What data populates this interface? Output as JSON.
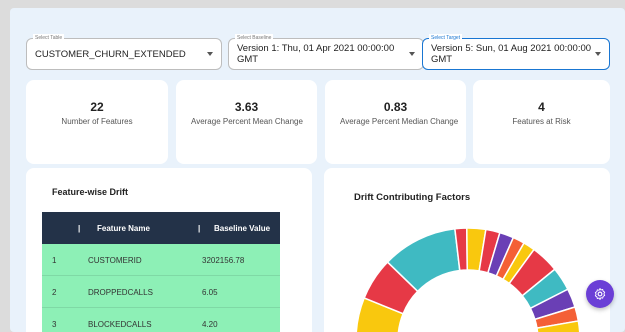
{
  "filters": {
    "table": {
      "legend": "Select Table",
      "value": "CUSTOMER_CHURN_EXTENDED"
    },
    "baseline": {
      "legend": "Select Baseline",
      "value": "Version 1: Thu, 01 Apr 2021 00:00:00 GMT"
    },
    "target": {
      "legend": "Select Target",
      "value": "Version 5: Sun, 01 Aug 2021 00:00:00 GMT"
    }
  },
  "metrics": [
    {
      "value": "22",
      "label": "Number of Features"
    },
    {
      "value": "3.63",
      "label": "Average Percent Mean Change"
    },
    {
      "value": "0.83",
      "label": "Average Percent Median Change"
    },
    {
      "value": "4",
      "label": "Features at Risk"
    }
  ],
  "drift_table": {
    "title": "Feature-wise Drift",
    "columns": [
      "Feature Name",
      "Baseline Value"
    ],
    "rows": [
      {
        "index": "1",
        "feature": "CUSTOMERID",
        "baseline": "3202156.78"
      },
      {
        "index": "2",
        "feature": "DROPPEDCALLS",
        "baseline": "6.05"
      },
      {
        "index": "3",
        "feature": "BLOCKEDCALLS",
        "baseline": "4.20"
      }
    ]
  },
  "drift_chart": {
    "title": "Drift Contributing Factors"
  },
  "icons": {
    "fab": "settings-icon",
    "dropdown": "caret-down-icon"
  },
  "colors": {
    "accent": "#1976d2",
    "fab": "#6b3fd6",
    "table_header": "#233248",
    "table_row": "#8df0b6"
  },
  "chart_data": {
    "type": "pie",
    "title": "Drift Contributing Factors",
    "segments": [
      {
        "color": "#f9c80e",
        "value": 9
      },
      {
        "color": "#e63946",
        "value": 9
      },
      {
        "color": "#3fbac2",
        "value": 16
      },
      {
        "color": "#e63946",
        "value": 2.5
      },
      {
        "color": "#f9c80e",
        "value": 4
      },
      {
        "color": "#e63946",
        "value": 3
      },
      {
        "color": "#6a3fb5",
        "value": 3
      },
      {
        "color": "#f46036",
        "value": 2.5
      },
      {
        "color": "#f9c80e",
        "value": 2.5
      },
      {
        "color": "#e63946",
        "value": 6
      },
      {
        "color": "#3fbac2",
        "value": 5
      },
      {
        "color": "#6a3fb5",
        "value": 4
      },
      {
        "color": "#f46036",
        "value": 3
      },
      {
        "color": "#f9c80e",
        "value": 4
      }
    ]
  }
}
